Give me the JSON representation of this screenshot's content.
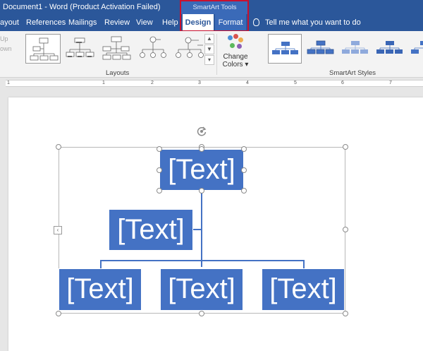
{
  "titlebar": {
    "document_title": "Document1  -  Word (Product Activation Failed)",
    "contextual_header": "SmartArt Tools"
  },
  "tabs": {
    "layout": "ayout",
    "references": "References",
    "mailings": "Mailings",
    "review": "Review",
    "view": "View",
    "help": "Help",
    "design": "Design",
    "format": "Format"
  },
  "tell_me": {
    "text": "Tell me what you want to do",
    "icon": "lightbulb-icon"
  },
  "ribbon": {
    "move_up": "Up",
    "move_down": "own",
    "layouts_label": "Layouts",
    "change_colors_line1": "Change",
    "change_colors_line2": "Colors",
    "change_colors_dropdown": "▾",
    "styles_label": "SmartArt Styles",
    "colors": {
      "accent": "#4472c4",
      "ribbon_blue": "#2b579a",
      "highlight": "#c8102e"
    }
  },
  "ruler": {
    "numbers": [
      "1",
      "1",
      "2",
      "3",
      "4",
      "5",
      "6",
      "7"
    ]
  },
  "smartart": {
    "top": "[Text]",
    "assistant": "[Text]",
    "child1": "[Text]",
    "child2": "[Text]",
    "child3": "[Text]",
    "collapse_arrow": "‹"
  }
}
